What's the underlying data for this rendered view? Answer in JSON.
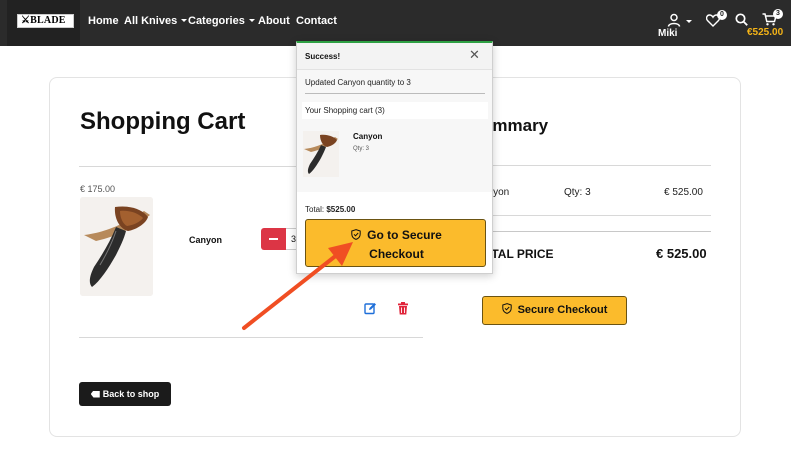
{
  "navbar": {
    "logo_text": "BLADE",
    "links": [
      {
        "label": "Home"
      },
      {
        "label": "All Knives"
      },
      {
        "label": "Categories"
      },
      {
        "label": "About"
      },
      {
        "label": "Contact"
      }
    ],
    "user_name": "Miki",
    "wishlist_count": "0",
    "cart_count": "3",
    "cart_total": "€525.00"
  },
  "cart": {
    "title": "Shopping Cart",
    "item": {
      "price": "€ 175.00",
      "name": "Canyon",
      "quantity": "3"
    },
    "back_label": "Back to shop"
  },
  "summary": {
    "title": "Summary",
    "title_visible": "ummary",
    "product_visible": "anyon",
    "qty": "Qty: 3",
    "price": "€ 525.00",
    "total_label_visible": "OTAL PRICE",
    "total_value": "€ 525.00",
    "secure_label": "Secure Checkout"
  },
  "popup": {
    "title": "Success!",
    "message": "Updated Canyon quantity to 3",
    "cart_label": "Your Shopping cart (3)",
    "item_name": "Canyon",
    "item_qty": "Qty: 3",
    "total_label": "Total:",
    "total_value": "$525.00",
    "checkout_line1": "Go to Secure",
    "checkout_line2": "Checkout"
  },
  "colors": {
    "navbar": "#2b2b2b",
    "accent": "#fbbb2c",
    "brand_gold": "#f5b417",
    "danger": "#dc3545",
    "edit": "#1e6fd9",
    "arrow": "#f04e23",
    "success": "#2ea043"
  },
  "icons": [
    "user-icon",
    "heart-icon",
    "search-icon",
    "cart-icon",
    "shield-icon",
    "edit-icon",
    "trash-icon",
    "close-icon",
    "back-icon",
    "arrow-annotation"
  ]
}
